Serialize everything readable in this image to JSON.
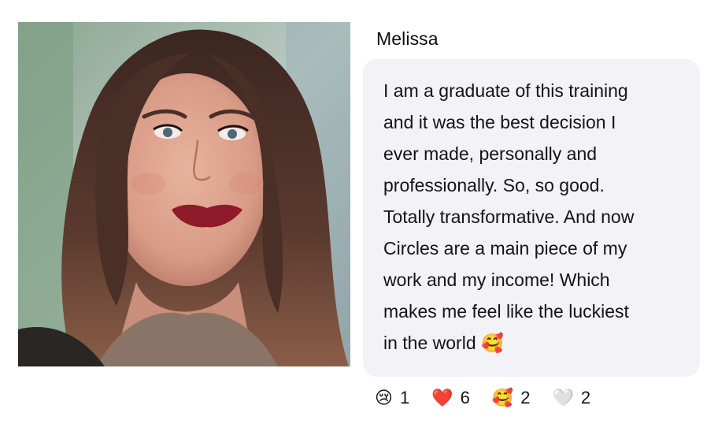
{
  "post": {
    "author": "Melissa",
    "message": "I am a graduate of this training\nand it was the best decision I\never made, personally and\nprofessionally. So, so good.\nTotally transformative. And now\nCircles are a main piece of my\nwork and my income! Which\nmakes me feel like the luckiest\nin the world 🥰"
  },
  "reactions": [
    {
      "icon": "😢",
      "count": "1"
    },
    {
      "icon": "❤️",
      "count": "6"
    },
    {
      "icon": "🥰",
      "count": "2"
    },
    {
      "icon": "🤍",
      "count": "2"
    }
  ]
}
